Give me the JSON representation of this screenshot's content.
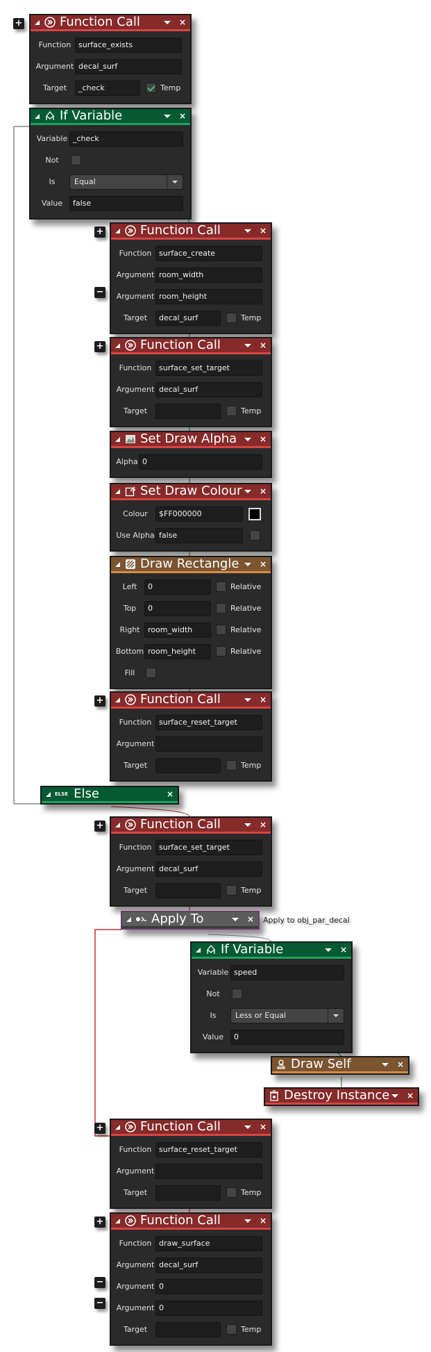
{
  "blocks": {
    "fc1": {
      "title": "Function Call",
      "function_label": "Function",
      "function": "surface_exists",
      "argument_label": "Argument",
      "argument": "decal_surf",
      "target_label": "Target",
      "target": "_check",
      "temp_label": "Temp",
      "temp_checked": true
    },
    "if1": {
      "title": "If Variable",
      "variable_label": "Variable",
      "variable": "_check",
      "not_label": "Not",
      "is_label": "Is",
      "is": "Equal",
      "value_label": "Value",
      "value": "false"
    },
    "fc2": {
      "title": "Function Call",
      "function_label": "Function",
      "function": "surface_create",
      "argument_label": "Argument",
      "argument1": "room_width",
      "argument2": "room_height",
      "target_label": "Target",
      "target": "decal_surf",
      "temp_label": "Temp"
    },
    "fc3": {
      "title": "Function Call",
      "function_label": "Function",
      "function": "surface_set_target",
      "argument_label": "Argument",
      "argument": "decal_surf",
      "target_label": "Target",
      "target": "",
      "temp_label": "Temp"
    },
    "alpha": {
      "title": "Set Draw Alpha",
      "alpha_label": "Alpha",
      "alpha": "0"
    },
    "colour": {
      "title": "Set Draw Colour",
      "colour_label": "Colour",
      "colour": "$FF000000",
      "swatch": "#000000",
      "use_alpha_label": "Use Alpha",
      "use_alpha": "false"
    },
    "rect": {
      "title": "Draw Rectangle",
      "left_label": "Left",
      "left": "0",
      "top_label": "Top",
      "top": "0",
      "right_label": "Right",
      "right": "room_width",
      "bottom_label": "Bottom",
      "bottom": "room_height",
      "relative_label": "Relative",
      "fill_label": "Fill"
    },
    "fc4": {
      "title": "Function Call",
      "function_label": "Function",
      "function": "surface_reset_target",
      "argument_label": "Argument",
      "argument": "",
      "target_label": "Target",
      "target": "",
      "temp_label": "Temp"
    },
    "else": {
      "title": "Else",
      "tag": "ELSE"
    },
    "fc5": {
      "title": "Function Call",
      "function_label": "Function",
      "function": "surface_set_target",
      "argument_label": "Argument",
      "argument": "decal_surf",
      "target_label": "Target",
      "target": "",
      "temp_label": "Temp"
    },
    "apply": {
      "title": "Apply To",
      "note": "Apply to obj_par_decal"
    },
    "if2": {
      "title": "If Variable",
      "variable_label": "Variable",
      "variable": "speed",
      "not_label": "Not",
      "is_label": "Is",
      "is": "Less or Equal",
      "value_label": "Value",
      "value": "0"
    },
    "drawself": {
      "title": "Draw Self"
    },
    "destroy": {
      "title": "Destroy Instance"
    },
    "fc6": {
      "title": "Function Call",
      "function_label": "Function",
      "function": "surface_reset_target",
      "argument_label": "Argument",
      "argument": "",
      "target_label": "Target",
      "target": "",
      "temp_label": "Temp"
    },
    "fc7": {
      "title": "Function Call",
      "function_label": "Function",
      "function": "draw_surface",
      "argument_label": "Argument",
      "argument1": "decal_surf",
      "argument2": "0",
      "argument3": "0",
      "target_label": "Target",
      "target": "",
      "temp_label": "Temp"
    }
  },
  "controls": {
    "plus": "+",
    "minus": "−",
    "close": "×"
  },
  "colors": {
    "function": "#862a2a",
    "control": "#055a33",
    "drawing": "#7b5430",
    "apply": "#5c5c5c"
  }
}
